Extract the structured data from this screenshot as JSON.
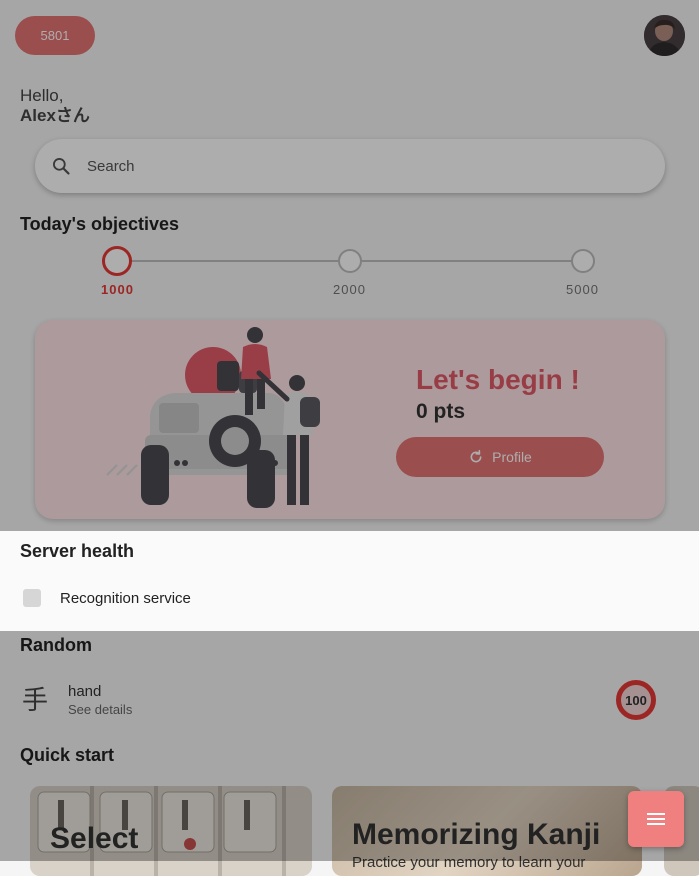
{
  "header": {
    "points": "5801",
    "greeting": "Hello,",
    "user_name": "Alexさん"
  },
  "search": {
    "placeholder": "Search",
    "value": ""
  },
  "objectives": {
    "title": "Today's objectives",
    "steps": [
      {
        "label": "1000",
        "active": true
      },
      {
        "label": "2000",
        "active": false
      },
      {
        "label": "5000",
        "active": false
      }
    ]
  },
  "promo_card": {
    "headline": "Let's begin !",
    "points_text": "0 pts",
    "button_label": "Profile"
  },
  "server_health": {
    "title": "Server health",
    "services": [
      {
        "label": "Recognition service"
      }
    ]
  },
  "random": {
    "title": "Random",
    "kanji": "手",
    "meaning": "hand",
    "link": "See details",
    "score": "100"
  },
  "quick_start": {
    "title": "Quick start",
    "cards": [
      {
        "label": "Select"
      },
      {
        "label": "Memorizing Kanji",
        "subtitle": "Practice your memory to learn your"
      }
    ]
  },
  "colors": {
    "accent": "#e57373",
    "accent_strong": "#e53935",
    "card_bg": "#ffe3e6"
  },
  "icons": {
    "search": "search-icon",
    "refresh": "refresh-icon",
    "menu": "menu-icon"
  }
}
